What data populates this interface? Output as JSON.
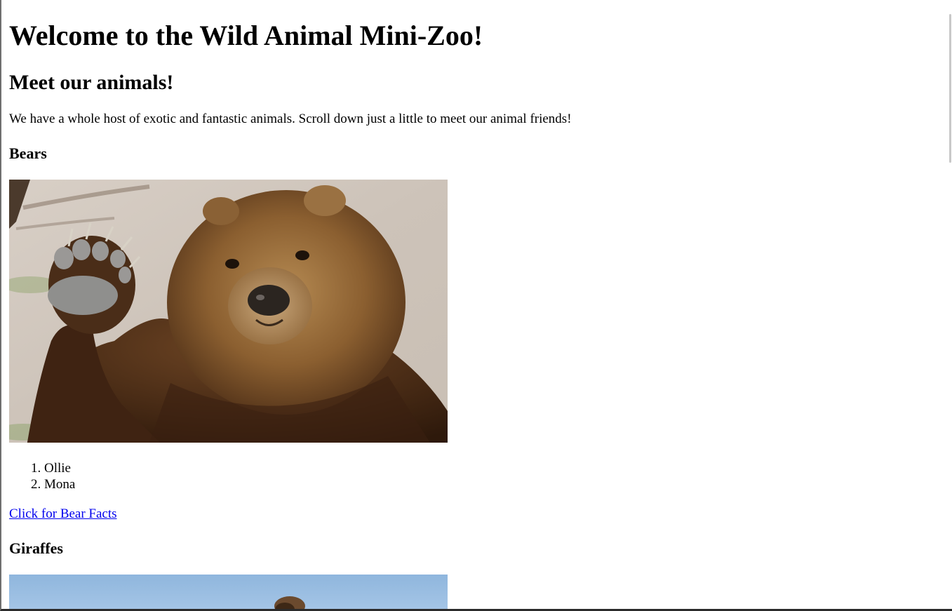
{
  "page": {
    "title": "Welcome to the Wild Animal Mini-Zoo!",
    "subtitle": "Meet our animals!",
    "intro": "We have a whole host of exotic and fantastic animals. Scroll down just a little to meet our animal friends!"
  },
  "bears": {
    "heading": "Bears",
    "names": [
      "Ollie",
      "Mona"
    ],
    "link_label": "Click for Bear Facts"
  },
  "giraffes": {
    "heading": "Giraffes"
  },
  "colors": {
    "link": "#0000ee",
    "text": "#000000",
    "background": "#ffffff"
  }
}
